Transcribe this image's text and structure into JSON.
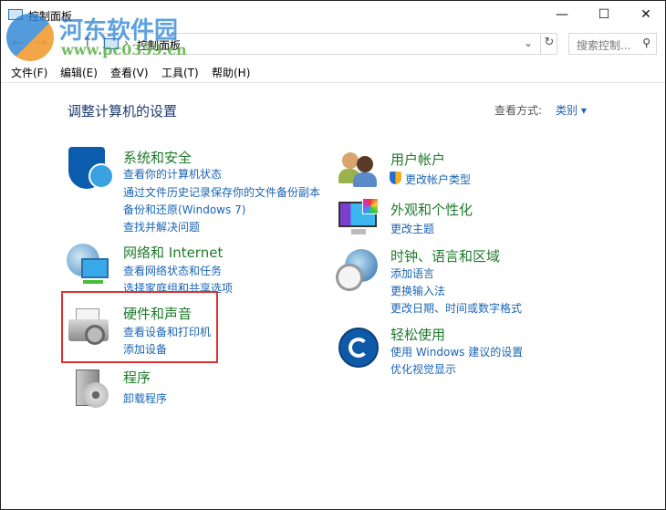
{
  "window": {
    "title": "控制面板",
    "minimize": "—",
    "maximize": "☐",
    "close": "✕"
  },
  "address": {
    "back": "←",
    "forward": "→",
    "up": "↑",
    "dropdown": "⌄",
    "path_sep": "›",
    "path": "控制面板",
    "refresh": "↻",
    "search_placeholder": "搜索控制...",
    "search_icon": "⚲"
  },
  "menu": [
    "文件(F)",
    "编辑(E)",
    "查看(V)",
    "工具(T)",
    "帮助(H)"
  ],
  "main": {
    "heading": "调整计算机的设置",
    "view_label": "查看方式:",
    "view_value": "类别",
    "view_arrow": "▾"
  },
  "left": [
    {
      "title": "系统和安全",
      "icon": "shield-icon",
      "links": [
        "查看你的计算机状态",
        "通过文件历史记录保存你的文件备份副本",
        "备份和还原(Windows 7)",
        "查找并解决问题"
      ]
    },
    {
      "title": "网络和 Internet",
      "icon": "network-icon",
      "links": [
        "查看网络状态和任务",
        "选择家庭组和共享选项"
      ]
    },
    {
      "title": "硬件和声音",
      "icon": "printer-icon",
      "links": [
        "查看设备和打印机",
        "添加设备"
      ]
    },
    {
      "title": "程序",
      "icon": "programs-icon",
      "links": [
        "卸载程序"
      ]
    }
  ],
  "right": [
    {
      "title": "用户帐户",
      "icon": "users-icon",
      "links": [
        "更改帐户类型"
      ]
    },
    {
      "title": "外观和个性化",
      "icon": "monitor-icon",
      "links": [
        "更改主题"
      ]
    },
    {
      "title": "时钟、语言和区域",
      "icon": "clock-globe-icon",
      "links": [
        "添加语言",
        "更换输入法",
        "更改日期、时间或数字格式"
      ]
    },
    {
      "title": "轻松使用",
      "icon": "ease-of-access-icon",
      "links": [
        "使用 Windows 建议的设置",
        "优化视觉显示"
      ]
    }
  ],
  "watermark": {
    "name": "河东软件园",
    "url": "www.pc0359.cn"
  },
  "colors": {
    "title_green": "#1e7a2a",
    "link_blue": "#1a64b4",
    "highlight_red": "#e03030"
  }
}
